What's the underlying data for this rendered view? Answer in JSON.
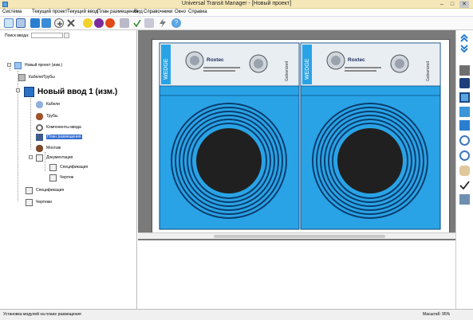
{
  "window": {
    "title": "Universal Transit Manager - [Новый проект]",
    "minimize": "–",
    "maximize": "□",
    "close": "✕"
  },
  "menu": {
    "items": [
      "Система",
      "Текущий проект",
      "Текущий ввод",
      "План размещения",
      "Вид",
      "Справочники",
      "Окно",
      "Справка"
    ]
  },
  "search": {
    "label": "Поиск ввода:",
    "value": ""
  },
  "tree": {
    "project": "Новый проект (изм.)",
    "cables_pipes": "Кабели/Трубы",
    "entry": "Новый ввод 1 (изм.)",
    "cables": "Кабели",
    "pipes": "Трубы",
    "components": "Компоненты ввода",
    "layout_plan": "План размещения",
    "montage": "Монтаж",
    "documentation": "Документация",
    "specification_sub": "Спецификация",
    "drawing": "Чертеж",
    "specification": "Спецификация",
    "drawings": "Чертежи"
  },
  "modules": [
    {
      "side_label": "WEDGE",
      "brand": "Roxtec",
      "galv": "Galvanized"
    },
    {
      "side_label": "WEDGE",
      "brand": "Roxtec",
      "galv": "Galvanized"
    }
  ],
  "status": {
    "left": "Установка модулей на плане размещения",
    "zoom": "Масштаб: 95%"
  },
  "colors": {
    "module_blue": "#29a3e6",
    "module_dark": "#1565a8",
    "canvas_bg": "#7a7a7a",
    "title_bar": "#f5e7b8"
  }
}
